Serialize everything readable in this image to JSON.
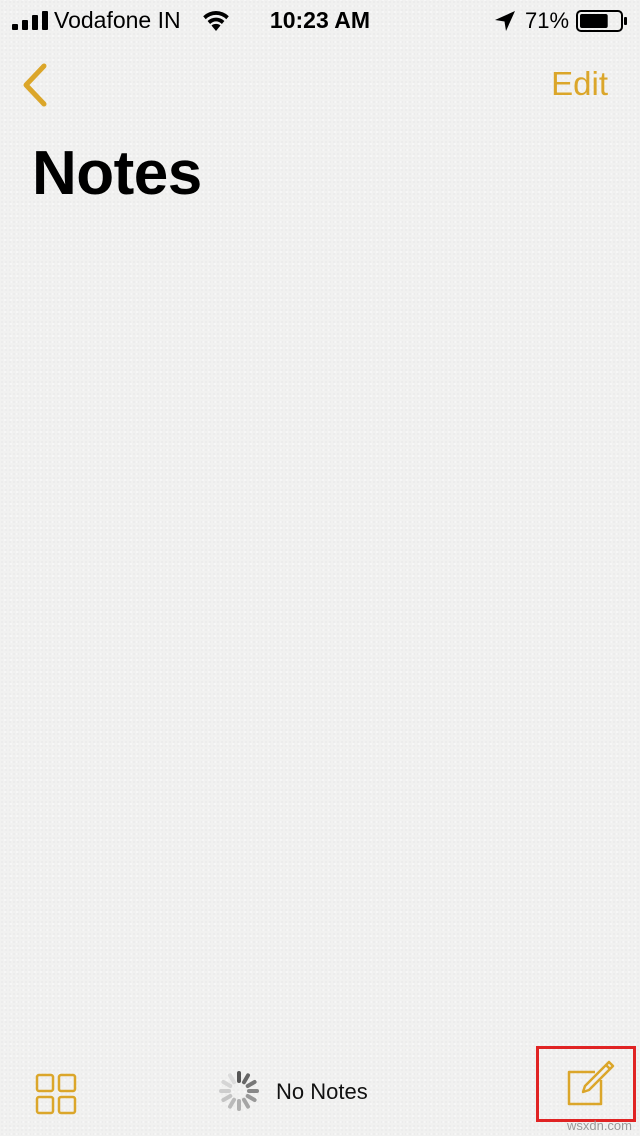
{
  "status_bar": {
    "carrier": "Vodafone IN",
    "time": "10:23 AM",
    "battery_percent": "71%",
    "battery_level": 0.71,
    "signal_bars": 4,
    "icons": [
      "signal-icon",
      "wifi-icon",
      "location-arrow-icon",
      "battery-icon"
    ]
  },
  "nav": {
    "back_icon": "chevron-left-icon",
    "edit_label": "Edit"
  },
  "page": {
    "title": "Notes"
  },
  "toolbar": {
    "gallery_icon": "gallery-grid-icon",
    "status_text": "No Notes",
    "spinner_icon": "loading-spinner-icon",
    "compose_icon": "compose-note-icon"
  },
  "colors": {
    "accent": "#dba62a",
    "highlight_box": "#e02323",
    "background": "#f1f1f0"
  },
  "watermark": "wsxdn.com"
}
